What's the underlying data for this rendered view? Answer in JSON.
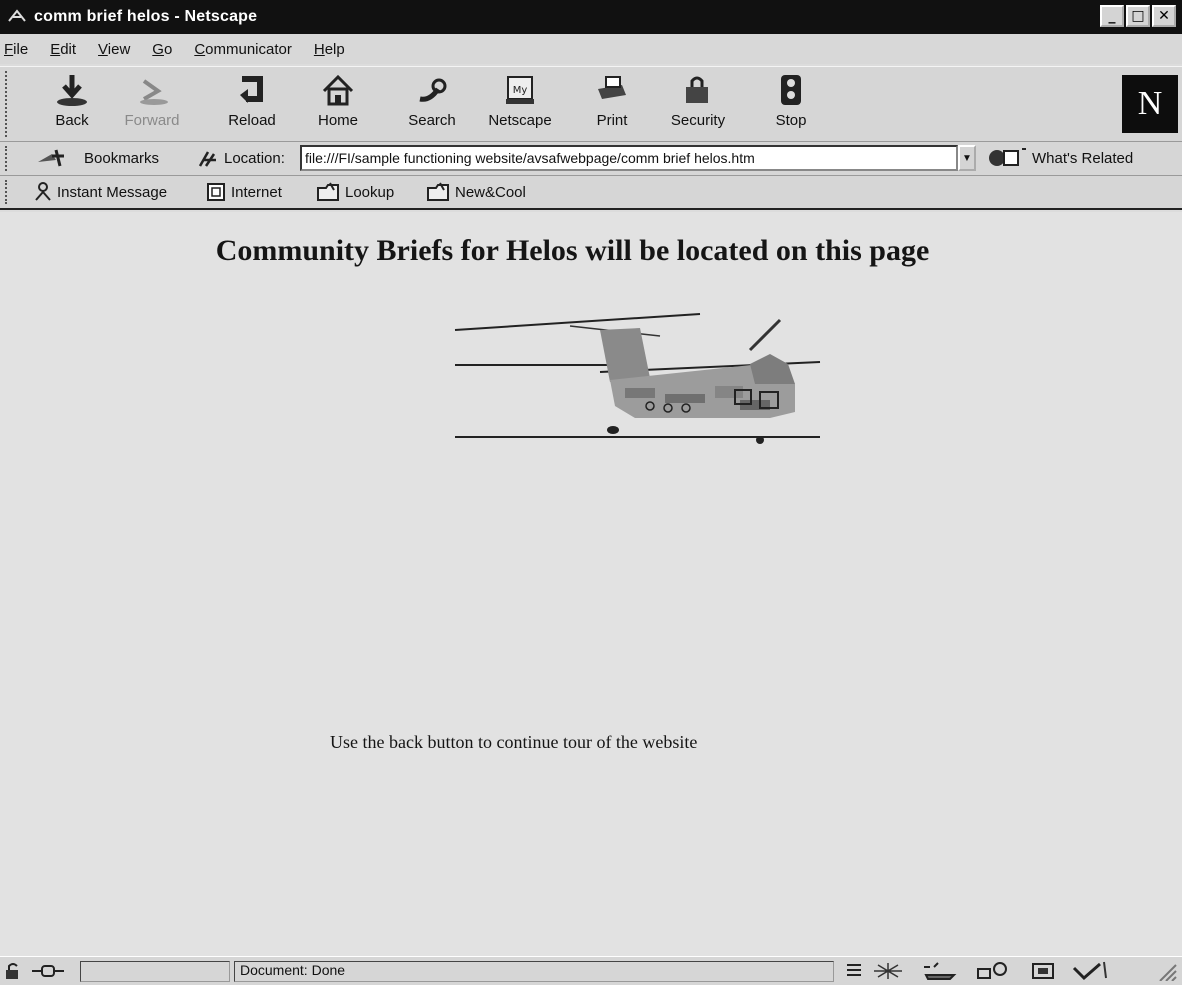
{
  "window": {
    "title": "comm brief helos - Netscape",
    "controls": [
      "_",
      "□",
      "✕"
    ]
  },
  "menu": [
    "File",
    "Edit",
    "View",
    "Go",
    "Communicator",
    "Help"
  ],
  "toolbar": {
    "buttons": [
      {
        "label": "Back",
        "icon": "back-arrow-icon"
      },
      {
        "label": "Forward",
        "icon": "forward-arrow-icon",
        "disabled": true
      },
      {
        "label": "Reload",
        "icon": "reload-icon"
      },
      {
        "label": "Home",
        "icon": "home-icon"
      },
      {
        "label": "Search",
        "icon": "search-icon"
      },
      {
        "label": "Netscape",
        "icon": "my-netscape-icon"
      },
      {
        "label": "Print",
        "icon": "print-icon"
      },
      {
        "label": "Security",
        "icon": "lock-icon"
      },
      {
        "label": "Stop",
        "icon": "stop-icon"
      }
    ],
    "logo": "N"
  },
  "location_bar": {
    "bookmarks_label": "Bookmarks",
    "location_label": "Location:",
    "url": "file:///FI/sample functioning website/avsafwebpage/comm brief helos.htm",
    "whats_related": "What's Related"
  },
  "personal_toolbar": [
    "Instant Message",
    "Internet",
    "Lookup",
    "New&Cool"
  ],
  "page": {
    "heading": "Community Briefs for Helos will be located on this page",
    "image": "helicopter-image",
    "text": "Use the back button to continue tour of the website"
  },
  "status": {
    "text": "Document: Done"
  },
  "colors": {
    "titlebar": "#111111",
    "chrome": "#d6d6d6",
    "page_background": "#e2e2e2"
  }
}
